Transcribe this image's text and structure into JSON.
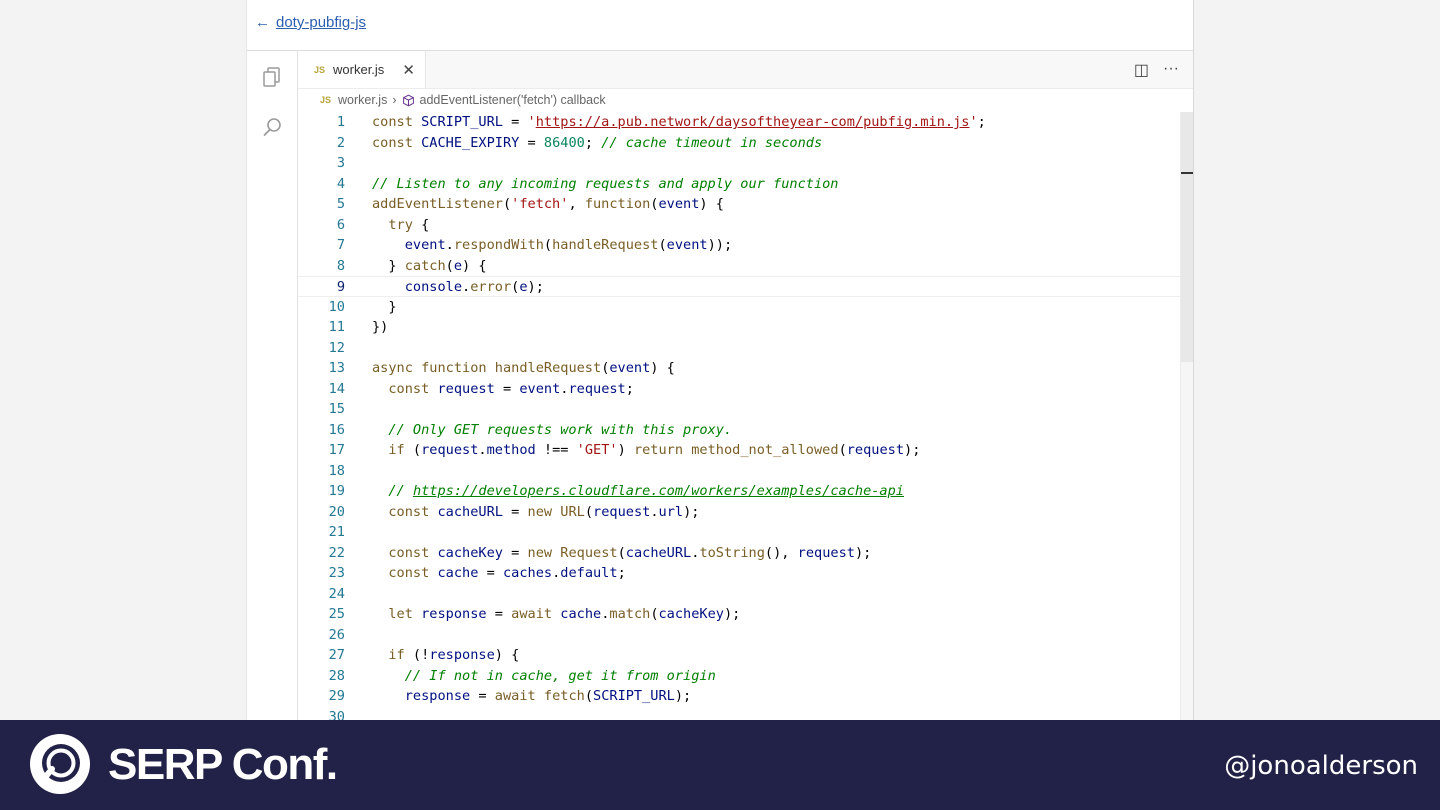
{
  "header": {
    "back_label": "doty-pubfig-js"
  },
  "tab": {
    "filename": "worker.js",
    "badge": "JS",
    "close": "✕"
  },
  "tab_actions": {
    "split": "◫",
    "more": "···"
  },
  "breadcrumb": {
    "file": "worker.js",
    "separator": "›",
    "symbol": "addEventListener('fetch') callback"
  },
  "editor": {
    "current_line": 9,
    "lines": [
      {
        "n": "1",
        "html": "<span class=\"kw\">const</span> <span class=\"var\">SCRIPT_URL</span> = <span class=\"str\">'<span class=\"link\">https://a.pub.network/daysoftheyear-com/pubfig.min.js</span>'</span>;"
      },
      {
        "n": "2",
        "html": "<span class=\"kw\">const</span> <span class=\"var\">CACHE_EXPIRY</span> = <span class=\"num\">86400</span>; <span class=\"com\">// cache timeout in seconds</span>"
      },
      {
        "n": "3",
        "html": ""
      },
      {
        "n": "4",
        "html": "<span class=\"com\">// Listen to any incoming requests and apply our function</span>"
      },
      {
        "n": "5",
        "html": "<span class=\"fn\">addEventListener</span>(<span class=\"str\">'fetch'</span>, <span class=\"kw\">function</span>(<span class=\"var\">event</span>) {"
      },
      {
        "n": "6",
        "html": "  <span class=\"kw\">try</span> {"
      },
      {
        "n": "7",
        "html": "    <span class=\"var\">event</span>.<span class=\"fn\">respondWith</span>(<span class=\"fn\">handleRequest</span>(<span class=\"var\">event</span>));"
      },
      {
        "n": "8",
        "html": "  } <span class=\"kw\">catch</span>(<span class=\"var\">e</span>) {"
      },
      {
        "n": "9",
        "html": "    <span class=\"var\">console</span>.<span class=\"fn\">error</span>(<span class=\"var\">e</span>);"
      },
      {
        "n": "10",
        "html": "  }"
      },
      {
        "n": "11",
        "html": "})"
      },
      {
        "n": "12",
        "html": ""
      },
      {
        "n": "13",
        "html": "<span class=\"kw\">async</span> <span class=\"kw\">function</span> <span class=\"fn\">handleRequest</span>(<span class=\"var\">event</span>) {"
      },
      {
        "n": "14",
        "html": "  <span class=\"kw\">const</span> <span class=\"var\">request</span> = <span class=\"var\">event</span>.<span class=\"var\">request</span>;"
      },
      {
        "n": "15",
        "html": ""
      },
      {
        "n": "16",
        "html": "  <span class=\"com\">// Only GET requests work with this proxy.</span>"
      },
      {
        "n": "17",
        "html": "  <span class=\"kw\">if</span> (<span class=\"var\">request</span>.<span class=\"var\">method</span> !== <span class=\"str\">'GET'</span>) <span class=\"kw\">return</span> <span class=\"fn\">method_not_allowed</span>(<span class=\"var\">request</span>);"
      },
      {
        "n": "18",
        "html": ""
      },
      {
        "n": "19",
        "html": "  <span class=\"com\">// <span class=\"link\">https://developers.cloudflare.com/workers/examples/cache-api</span></span>"
      },
      {
        "n": "20",
        "html": "  <span class=\"kw\">const</span> <span class=\"var\">cacheURL</span> = <span class=\"kw\">new</span> <span class=\"fn\">URL</span>(<span class=\"var\">request</span>.<span class=\"var\">url</span>);"
      },
      {
        "n": "21",
        "html": ""
      },
      {
        "n": "22",
        "html": "  <span class=\"kw\">const</span> <span class=\"var\">cacheKey</span> = <span class=\"kw\">new</span> <span class=\"fn\">Request</span>(<span class=\"var\">cacheURL</span>.<span class=\"fn\">toString</span>(), <span class=\"var\">request</span>);"
      },
      {
        "n": "23",
        "html": "  <span class=\"kw\">const</span> <span class=\"var\">cache</span> = <span class=\"var\">caches</span>.<span class=\"var\">default</span>;"
      },
      {
        "n": "24",
        "html": ""
      },
      {
        "n": "25",
        "html": "  <span class=\"kw\">let</span> <span class=\"var\">response</span> = <span class=\"kw\">await</span> <span class=\"var\">cache</span>.<span class=\"fn\">match</span>(<span class=\"var\">cacheKey</span>);"
      },
      {
        "n": "26",
        "html": ""
      },
      {
        "n": "27",
        "html": "  <span class=\"kw\">if</span> (!<span class=\"var\">response</span>) {"
      },
      {
        "n": "28",
        "html": "    <span class=\"com\">// If not in cache, get it from origin</span>"
      },
      {
        "n": "29",
        "html": "    <span class=\"var\">response</span> = <span class=\"kw\">await</span> <span class=\"fn\">fetch</span>(<span class=\"var\">SCRIPT_URL</span>);"
      },
      {
        "n": "30",
        "html": ""
      }
    ]
  },
  "footer": {
    "brand": "SERP Conf.",
    "handle": "@jonoalderson"
  },
  "colors": {
    "footer_bg": "#222248",
    "link": "#2b5fb0"
  }
}
